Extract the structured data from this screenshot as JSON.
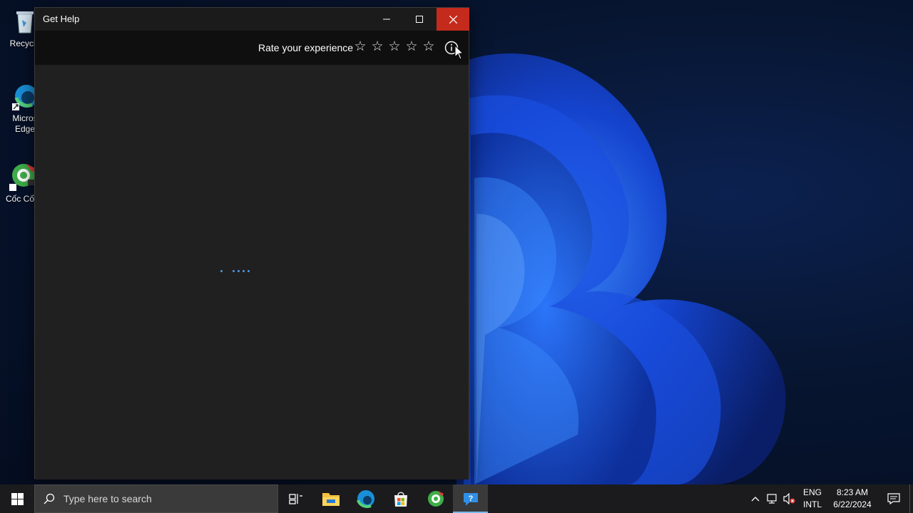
{
  "desktop": {
    "icons": [
      {
        "label": "Recycle",
        "name": "recycle-bin"
      },
      {
        "label": "Micros\nEdge",
        "name": "microsoft-edge"
      },
      {
        "label": "Cốc Cốc",
        "name": "coc-coc"
      }
    ]
  },
  "window": {
    "title": "Get Help",
    "minimize_icon": "minimize-icon",
    "maximize_icon": "maximize-icon",
    "close_icon": "close-icon",
    "toolbar": {
      "rate_label": "Rate your experience",
      "stars": [
        "☆",
        "☆",
        "☆",
        "☆",
        "☆"
      ],
      "info_icon": "info-icon"
    },
    "content": {
      "loading": true
    }
  },
  "taskbar": {
    "search_placeholder": "Type here to search",
    "apps": [
      "task-view",
      "file-explorer",
      "microsoft-edge",
      "microsoft-store",
      "coc-coc",
      "get-help"
    ],
    "language": {
      "line1": "ENG",
      "line2": "INTL"
    },
    "clock": {
      "time": "8:23 AM",
      "date": "6/22/2024"
    }
  },
  "colors": {
    "close_button": "#c42b1c",
    "accent": "#4a9be8",
    "window_bg": "#202020",
    "toolbar_bg": "#0f0f0f"
  }
}
